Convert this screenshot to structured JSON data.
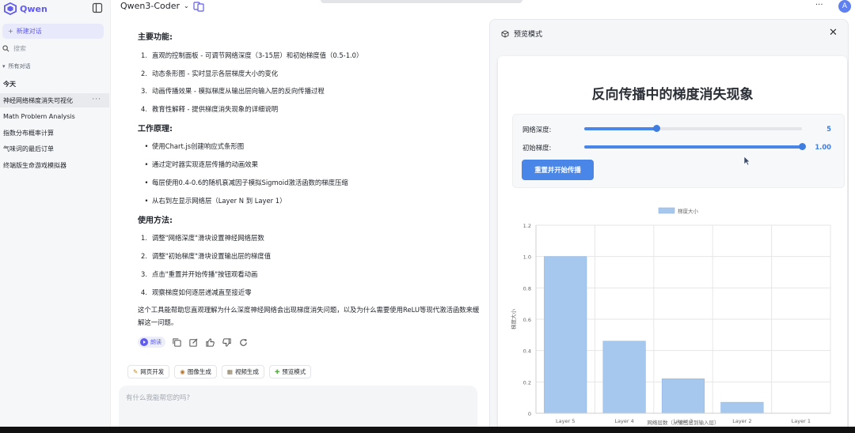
{
  "sidebar": {
    "brand": "Qwen",
    "new_chat": "新建对话",
    "search_placeholder": "搜索",
    "all_chats": "所有对话",
    "section_today": "今天",
    "items": [
      {
        "label": "神经网络梯度消失可视化",
        "active": true
      },
      {
        "label": "Math Problem Analysis",
        "active": false
      },
      {
        "label": "指数分布概率计算",
        "active": false
      },
      {
        "label": "气味词的最后订单",
        "active": false
      },
      {
        "label": "终端版生命游戏模拟器",
        "active": false
      }
    ]
  },
  "topbar": {
    "model": "Qwen3-Coder",
    "more": "···",
    "avatar": "A"
  },
  "message": {
    "sections": [
      {
        "heading": "主要功能:",
        "style": "numbered",
        "items": [
          "直观的控制面板 - 可调节网络深度（3-15层）和初始梯度值（0.5-1.0）",
          "动态条形图 - 实时显示各层梯度大小的变化",
          "动画传播效果 - 模拟梯度从输出层向输入层的反向传播过程",
          "教育性解释 - 提供梯度消失现象的详细说明"
        ]
      },
      {
        "heading": "工作原理:",
        "style": "bullet",
        "items": [
          "使用Chart.js创建响应式条形图",
          "通过定时器实现逐层传播的动画效果",
          "每层使用0.4-0.6的随机衰减因子模拟Sigmoid激活函数的梯度压缩",
          "从右到左显示网络层（Layer N 到 Layer 1）"
        ]
      },
      {
        "heading": "使用方法:",
        "style": "numbered",
        "items": [
          "调整\"网络深度\"滑块设置神经网络层数",
          "调整\"初始梯度\"滑块设置输出层的梯度值",
          "点击\"重置并开始传播\"按钮观看动画",
          "观察梯度如何逐层递减直至接近零"
        ]
      }
    ],
    "summary": "这个工具能帮助您直观理解为什么深度神经网络会出现梯度消失问题，以及为什么需要使用ReLU等现代激活函数来缓解这一问题。",
    "play_label": "朗读"
  },
  "chips": [
    {
      "label": "网页开发",
      "icon": "code-icon"
    },
    {
      "label": "图像生成",
      "icon": "palette-icon"
    },
    {
      "label": "视频生成",
      "icon": "film-icon"
    },
    {
      "label": "预览模式",
      "icon": "puzzle-icon"
    }
  ],
  "input": {
    "placeholder": "有什么我能帮您的吗?"
  },
  "preview": {
    "header": "预览模式",
    "title": "反向传播中的梯度消失现象",
    "depth_label": "网络深度:",
    "depth_value": "5",
    "depth_fraction": 0.33,
    "grad_label": "初始梯度:",
    "grad_value": "1.00",
    "grad_fraction": 1.0,
    "reset_button": "重置并开始传播",
    "accent": "#4a86e8"
  },
  "chart_data": {
    "type": "bar",
    "categories": [
      "Layer 5",
      "Layer 4",
      "Layer 3",
      "Layer 2",
      "Layer 1"
    ],
    "series": [
      {
        "name": "梯度大小",
        "values": [
          1.0,
          0.46,
          0.22,
          0.07,
          0.0
        ]
      }
    ],
    "xlabel": "网络层数（从输出层到输入层）",
    "ylabel": "梯度大小",
    "ylim": [
      0,
      1.2
    ],
    "yticks": [
      "0",
      "0.2",
      "0.4",
      "0.6",
      "0.8",
      "1.0",
      "1.2"
    ],
    "grid": true,
    "legend": "top-center",
    "bar_color": "#a6c8ef",
    "bar_border": "#8fb7e6"
  }
}
